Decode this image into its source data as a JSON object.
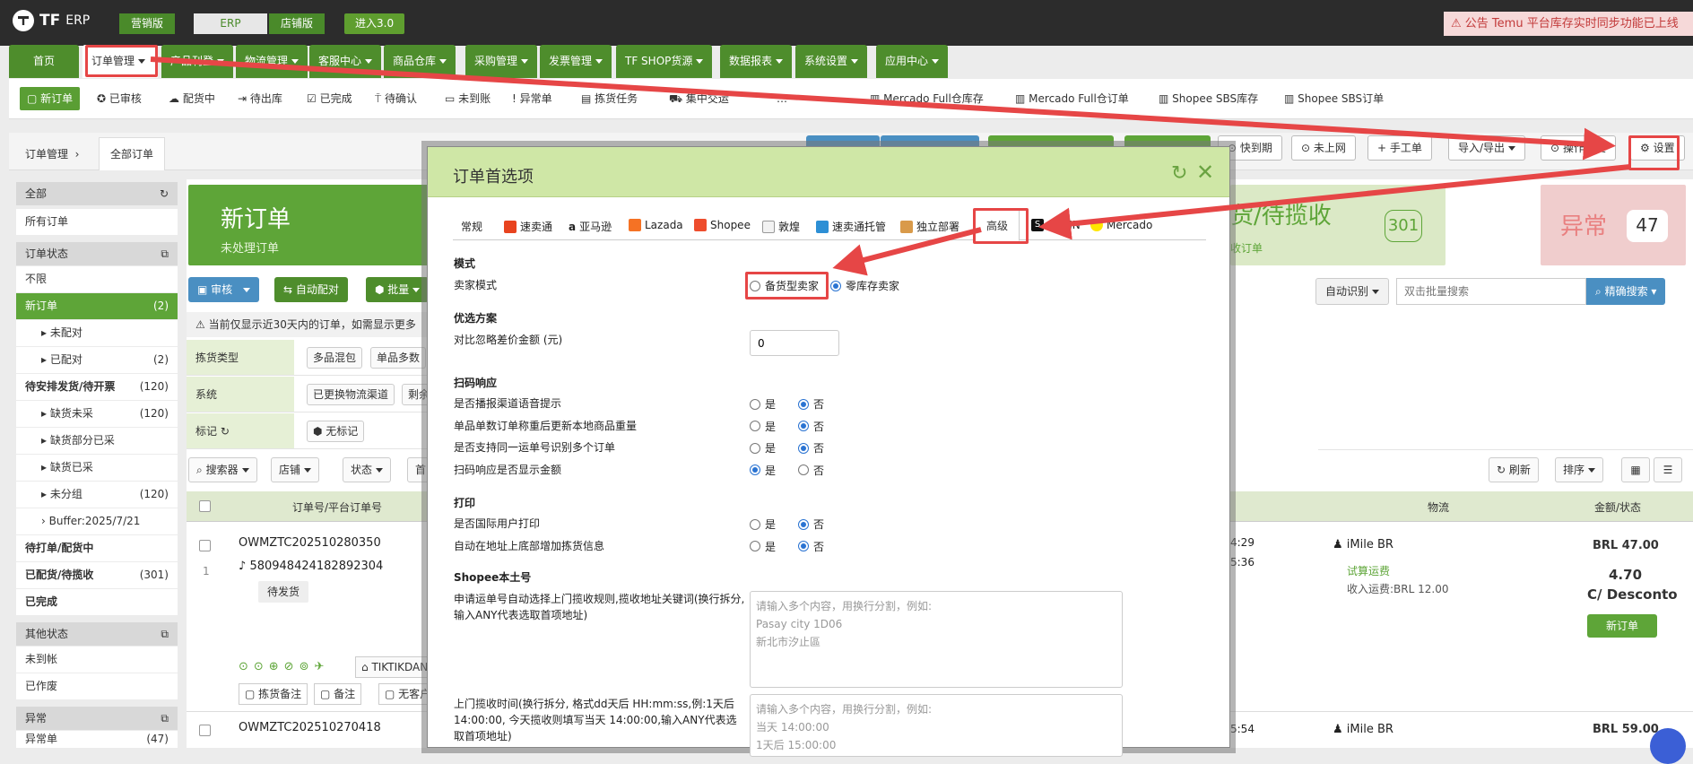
{
  "topbar": {
    "logo": "TF",
    "logo_sub": "ERP",
    "version_tabs": [
      "营销版",
      "ERP",
      "店铺版"
    ],
    "enter_button": "进入3.0",
    "notice": "公告 Temu 平台库存实时同步功能已上线"
  },
  "main_nav": [
    "首页",
    "订单管理",
    "产品刊登",
    "物流管理",
    "客服中心",
    "商品仓库",
    "采购管理",
    "发票管理",
    "TF SHOP货源",
    "数据报表",
    "系统设置",
    "应用中心"
  ],
  "sub_nav": [
    "新订单",
    "已审核",
    "配货中",
    "待出库",
    "已完成",
    "待确认",
    "未到账",
    "异常单",
    "拣货任务",
    "集中交运",
    "…",
    "Mercado Full仓库存",
    "Mercado Full仓订单",
    "Shopee SBS库存",
    "Shopee SBS订单"
  ],
  "breadcrumb": {
    "root": "订单管理",
    "current": "全部订单"
  },
  "toolbar": {
    "quick_expire": "快到期",
    "not_online": "未上网",
    "manual_order": "手工单",
    "import_export": "导入/导出",
    "history": "操作历史",
    "settings": "设置"
  },
  "sidebar": {
    "all_header": "全部",
    "all_orders": "所有订单",
    "status_header": "订单状态",
    "items": [
      {
        "label": "不限",
        "count": ""
      },
      {
        "label": "新订单",
        "count": "(2)"
      },
      {
        "label": "未配对",
        "count": ""
      },
      {
        "label": "已配对",
        "count": "(2)"
      },
      {
        "label": "待安排发货/待开票",
        "count": "(120)"
      },
      {
        "label": "缺货未采",
        "count": "(120)"
      },
      {
        "label": "缺货部分已采",
        "count": ""
      },
      {
        "label": "缺货已采",
        "count": ""
      },
      {
        "label": "未分组",
        "count": "(120)"
      },
      {
        "label": "Buffer:2025/7/21",
        "count": ""
      },
      {
        "label": "待打单/配货中",
        "count": ""
      },
      {
        "label": "已配货/待揽收",
        "count": "(301)"
      },
      {
        "label": "已完成",
        "count": ""
      }
    ],
    "other_header": "其他状态",
    "other_items": [
      "未到帐",
      "已作废"
    ],
    "exception_header": "异常",
    "exception_item": "异常单",
    "exception_count": "(47)"
  },
  "kpi": {
    "new_title": "新订单",
    "new_sub": "未处理订单",
    "ship_title": "货/待揽收",
    "ship_sub": "收订单",
    "ship_count": "301",
    "abn_title": "异常",
    "abn_count": "47"
  },
  "action_buttons": [
    "审核",
    "自动配对",
    "批量"
  ],
  "warning": "当前仅显示近30天内的订单，如需显示更多",
  "filters": {
    "pick_type_label": "拣货类型",
    "pick_type_chips": [
      "多品混包",
      "单品多数"
    ],
    "system_label": "系统",
    "system_chips": [
      "已更换物流渠道",
      "剩余"
    ],
    "tag_label": "标记",
    "tag_chip": "无标记"
  },
  "search": {
    "filter_buttons": [
      "搜索器",
      "店铺",
      "状态",
      "首"
    ],
    "auto_identify": "自动识别",
    "placeholder": "双击批量搜索",
    "exact_search": "精确搜索",
    "refresh": "刷新",
    "sort": "排序"
  },
  "table": {
    "headers": [
      "订单号/平台订单号",
      "物流",
      "金额/状态"
    ],
    "rows": [
      {
        "index": "1",
        "order_no": "OWMZTC202510280350",
        "platform_no": "580948424182892304",
        "status_tag": "待发货",
        "time1": "4:29",
        "time2": "5:36",
        "logistics": "iMile BR",
        "trial_fee": "试算运费",
        "recv_fee": "收入运费:BRL 12.00",
        "amount": "BRL 47.00",
        "amount2": "4.70",
        "desc": "C/ Desconto",
        "state_btn": "新订单",
        "shop": "TIKTIKDAN",
        "notes": [
          "拣货备注",
          "备注",
          "无客户"
        ]
      },
      {
        "index": "",
        "order_no": "OWMZTC202510270418",
        "time1": "5:54",
        "logistics": "iMile BR",
        "amount": "BRL 59.00"
      }
    ]
  },
  "modal": {
    "title": "订单首选项",
    "tabs": [
      "常规",
      "速卖通",
      "亚马逊",
      "Lazada",
      "Shopee",
      "敦煌",
      "速卖通托管",
      "独立部署",
      "高级",
      "SHEIN",
      "Mercado"
    ],
    "sections": {
      "mode": "模式",
      "optimize": "优选方案",
      "scan": "扫码响应",
      "print": "打印",
      "shopee_local": "Shopee本土号"
    },
    "seller_mode_label": "卖家模式",
    "seller_mode_options": [
      "备货型卖家",
      "零库存卖家"
    ],
    "seller_mode_selected": 1,
    "diff_label": "对比忽略差价金额 (元)",
    "diff_value": "0",
    "yes": "是",
    "no": "否",
    "scan_items": [
      {
        "label": "是否播报渠道语音提示",
        "value": "no"
      },
      {
        "label": "单品单数订单称重后更新本地商品重量",
        "value": "no"
      },
      {
        "label": "是否支持同一运单号识别多个订单",
        "value": "no"
      },
      {
        "label": "扫码响应是否显示金额",
        "value": "yes"
      }
    ],
    "print_items": [
      {
        "label": "是否国际用户打印",
        "value": "no"
      },
      {
        "label": "自动在地址上底部增加拣货信息",
        "value": "no"
      }
    ],
    "shopee_label1": "申请运单号自动选择上门揽收规则,揽收地址关键词(换行拆分, 输入ANY代表选取首项地址)",
    "shopee_placeholder1": "请输入多个内容，用换行分割，例如:\nPasay city 1D06\n新北市汐止區",
    "shopee_label2": "上门揽收时间(换行拆分, 格式dd天后 HH:mm:ss,例:1天后 14:00:00, 今天揽收则填写当天 14:00:00,输入ANY代表选取首项地址)",
    "shopee_placeholder2": "请输入多个内容，用换行分割，例如:\n当天 14:00:00\n1天后 15:00:00"
  },
  "colors": {
    "brand_green": "#4e8d2c",
    "annotation_red": "#e64646",
    "modal_header": "#cfe7a6"
  }
}
